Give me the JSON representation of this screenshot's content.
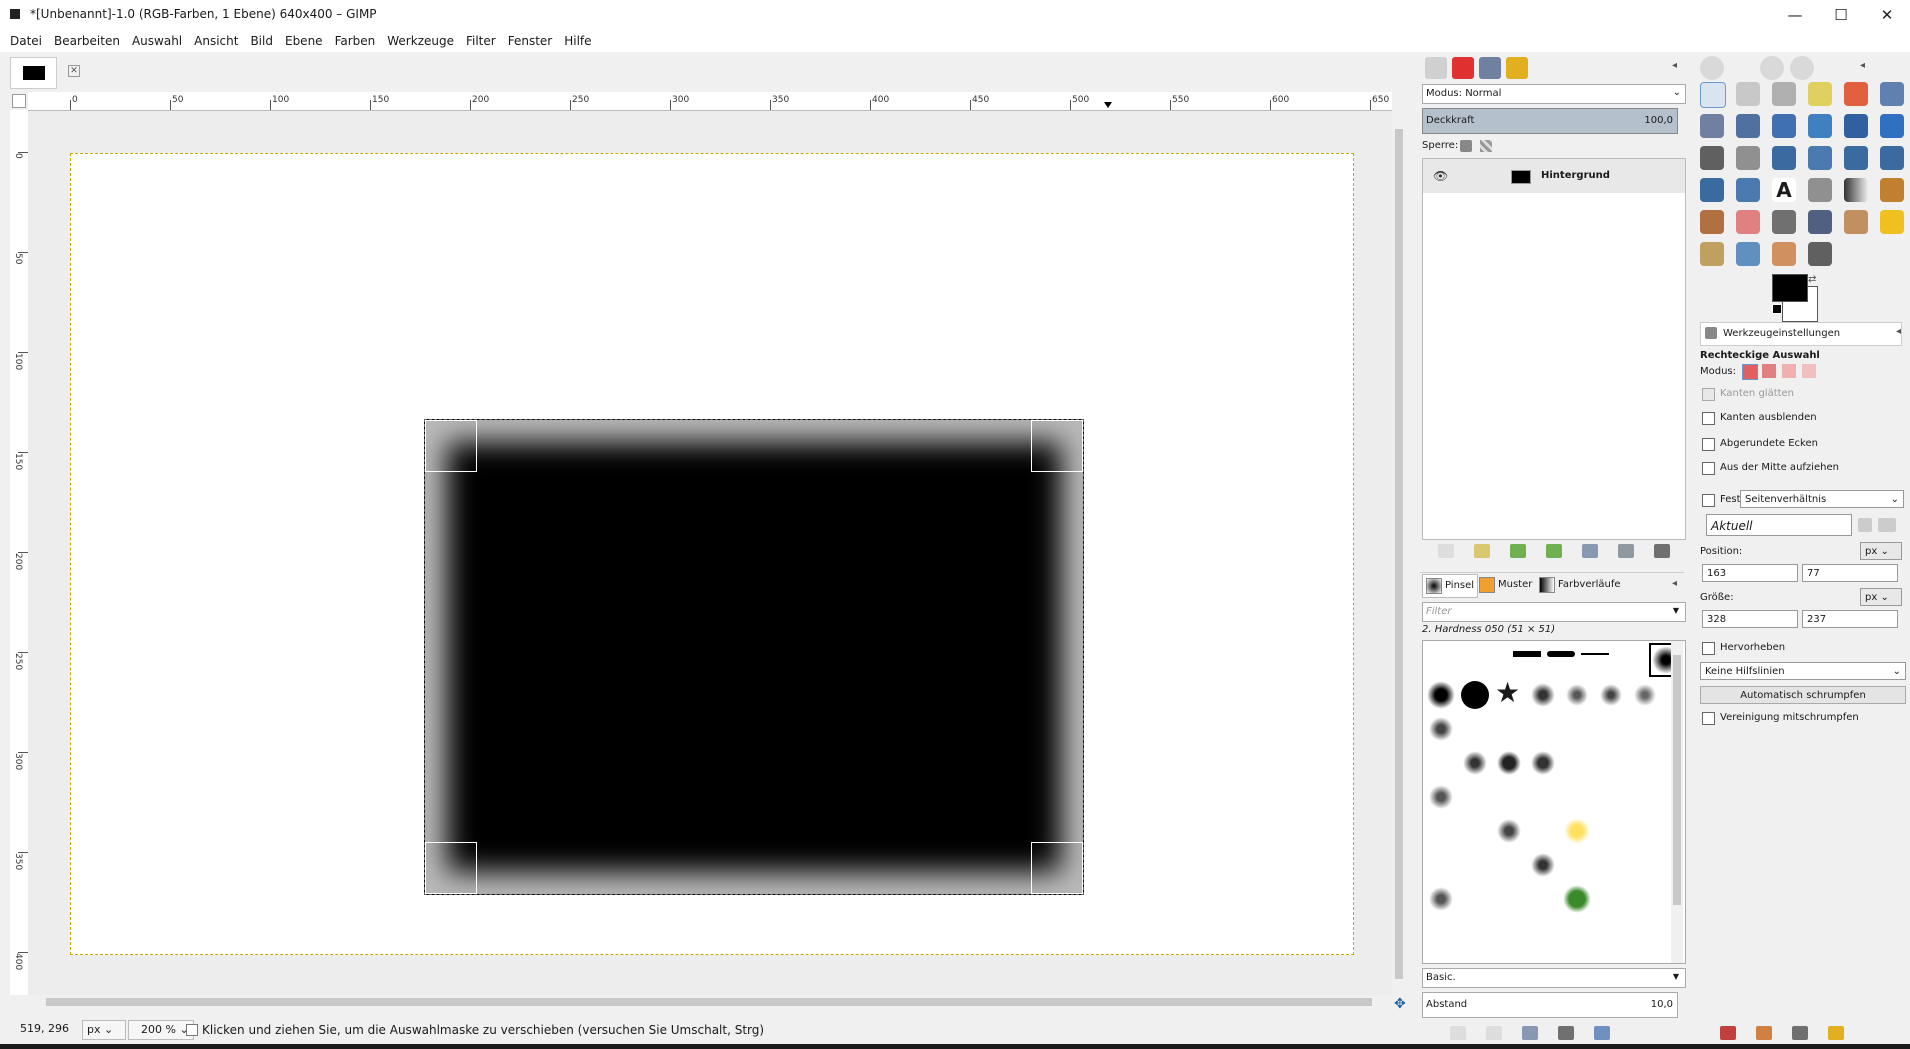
{
  "window": {
    "title": "*[Unbenannt]-1.0 (RGB-Farben, 1 Ebene) 640x400 – GIMP",
    "minimize": "—",
    "maximize": "☐",
    "close": "✕"
  },
  "menu": [
    "Datei",
    "Bearbeiten",
    "Auswahl",
    "Ansicht",
    "Bild",
    "Ebene",
    "Farben",
    "Werkzeuge",
    "Filter",
    "Fenster",
    "Hilfe"
  ],
  "ruler": {
    "h_labels": [
      "0",
      "50",
      "100",
      "150",
      "200",
      "250",
      "300",
      "350",
      "400",
      "450",
      "500",
      "550",
      "600",
      "650"
    ],
    "v_labels": [
      "0",
      "50",
      "100",
      "150",
      "200",
      "250",
      "300",
      "350",
      "400"
    ]
  },
  "status": {
    "coords": "519, 296",
    "unit": "px",
    "zoom": "200 %",
    "message": "Klicken und ziehen Sie, um die Auswahlmaske zu verschieben (versuchen Sie Umschalt, Strg)"
  },
  "layers": {
    "mode_label": "Modus: Normal",
    "opacity_label": "Deckkraft",
    "opacity_value": "100,0",
    "lock_label": "Sperre:",
    "layer_name": "Hintergrund"
  },
  "brushes": {
    "tab_brush": "Pinsel",
    "tab_pattern": "Muster",
    "tab_gradient": "Farbverläufe",
    "filter_placeholder": "Filter",
    "current_brush": "2. Hardness 050 (51 × 51)",
    "preset": "Basic.",
    "spacing_label": "Abstand",
    "spacing_value": "10,0"
  },
  "tool_options": {
    "tab_label": "Werkzeugeinstellungen",
    "tool_name": "Rechteckige Auswahl",
    "mode_label": "Modus:",
    "antialias": "Kanten glätten",
    "feather": "Kanten ausblenden",
    "rounded": "Abgerundete Ecken",
    "from_center": "Aus der Mitte aufziehen",
    "fixed_label": "Fest:",
    "fixed_value": "Seitenverhältnis",
    "aspect_value": "Aktuell",
    "position_label": "Position:",
    "position_unit": "px",
    "pos_x": "163",
    "pos_y": "77",
    "size_label": "Größe:",
    "size_unit": "px",
    "size_w": "328",
    "size_h": "237",
    "highlight": "Hervorheben",
    "guides_value": "Keine Hilfslinien",
    "autoshrink": "Automatisch schrumpfen",
    "shrink_merged": "Vereinigung mitschrumpfen"
  },
  "colors": {
    "foreground": "#000000",
    "background": "#ffffff",
    "selection_marquee": "#c8a800"
  }
}
